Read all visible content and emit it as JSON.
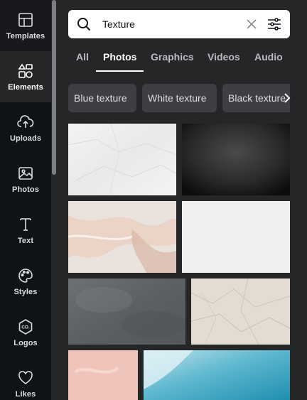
{
  "sidebar": {
    "items": [
      {
        "label": "Templates",
        "icon": "templates-icon"
      },
      {
        "label": "Elements",
        "icon": "elements-icon"
      },
      {
        "label": "Uploads",
        "icon": "uploads-icon"
      },
      {
        "label": "Photos",
        "icon": "photos-icon"
      },
      {
        "label": "Text",
        "icon": "text-icon"
      },
      {
        "label": "Styles",
        "icon": "styles-icon"
      },
      {
        "label": "Logos",
        "icon": "logos-icon"
      },
      {
        "label": "Likes",
        "icon": "likes-icon"
      }
    ],
    "active": "Elements"
  },
  "search": {
    "value": "Texture"
  },
  "tabs": [
    {
      "label": "All"
    },
    {
      "label": "Photos"
    },
    {
      "label": "Graphics"
    },
    {
      "label": "Videos"
    },
    {
      "label": "Audio"
    }
  ],
  "active_tab": "Photos",
  "chips": [
    {
      "label": "Blue texture"
    },
    {
      "label": "White texture"
    },
    {
      "label": "Black texture"
    }
  ],
  "colors": {
    "panel": "#252627",
    "rail": "#0e1318",
    "chip": "#3d3f42"
  }
}
